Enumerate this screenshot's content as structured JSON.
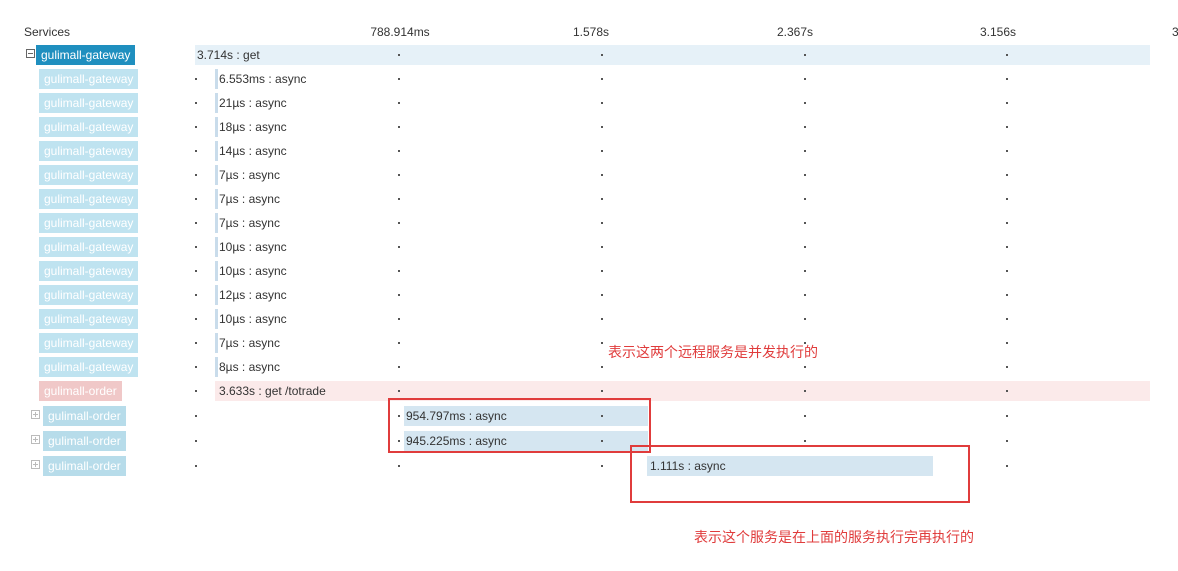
{
  "header": {
    "services_label": "Services",
    "ticks": [
      "788.914ms",
      "1.578s",
      "2.367s",
      "3.156s",
      "3"
    ]
  },
  "rows": [
    {
      "service": "gulimall-gateway",
      "label": "3.714s : get"
    },
    {
      "service": "gulimall-gateway",
      "label": "6.553ms : async"
    },
    {
      "service": "gulimall-gateway",
      "label": "21µs : async"
    },
    {
      "service": "gulimall-gateway",
      "label": "18µs : async"
    },
    {
      "service": "gulimall-gateway",
      "label": "14µs : async"
    },
    {
      "service": "gulimall-gateway",
      "label": "7µs : async"
    },
    {
      "service": "gulimall-gateway",
      "label": "7µs : async"
    },
    {
      "service": "gulimall-gateway",
      "label": "7µs : async"
    },
    {
      "service": "gulimall-gateway",
      "label": "10µs : async"
    },
    {
      "service": "gulimall-gateway",
      "label": "10µs : async"
    },
    {
      "service": "gulimall-gateway",
      "label": "12µs : async"
    },
    {
      "service": "gulimall-gateway",
      "label": "10µs : async"
    },
    {
      "service": "gulimall-gateway",
      "label": "7µs : async"
    },
    {
      "service": "gulimall-gateway",
      "label": "8µs : async"
    },
    {
      "service": "gulimall-order",
      "label": "3.633s : get /totrade"
    },
    {
      "service": "gulimall-order",
      "label": "954.797ms : async"
    },
    {
      "service": "gulimall-order",
      "label": "945.225ms : async"
    },
    {
      "service": "gulimall-order",
      "label": "1.111s : async"
    }
  ],
  "annotations": {
    "parallel": "表示这两个远程服务是并发执行的",
    "sequential": "表示这个服务是在上面的服务执行完再执行的"
  },
  "colors": {
    "annotation": "#e03c3c",
    "primary_service": "#1f8fbf"
  }
}
